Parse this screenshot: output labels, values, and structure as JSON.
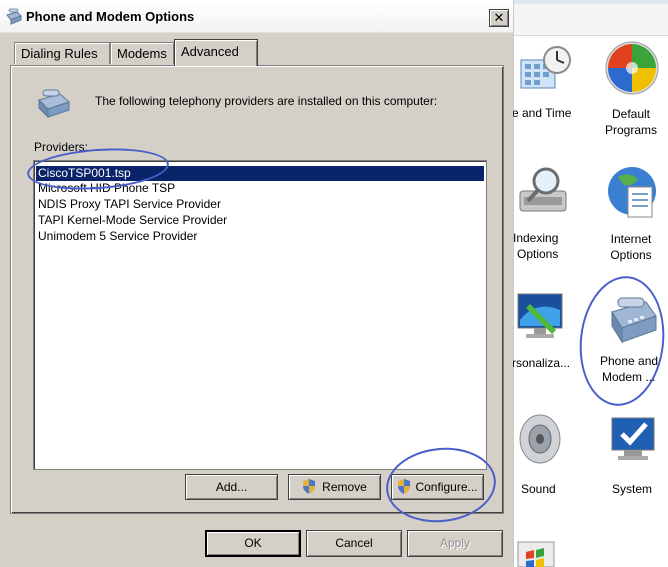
{
  "dialog": {
    "title": "Phone and Modem Options",
    "close_label": "✕",
    "tabs": [
      {
        "label": "Dialing Rules"
      },
      {
        "label": "Modems"
      },
      {
        "label": "Advanced"
      }
    ],
    "intro_text": "The following telephony providers are installed on this computer:",
    "providers_label": "Providers:",
    "providers": [
      "CiscoTSP001.tsp",
      "Microsoft HID Phone TSP",
      "NDIS Proxy TAPI Service Provider",
      "TAPI Kernel-Mode Service Provider",
      "Unimodem 5 Service Provider"
    ],
    "selected_provider_index": 0,
    "buttons": {
      "add": "Add...",
      "remove": "Remove",
      "configure": "Configure...",
      "ok": "OK",
      "cancel": "Cancel",
      "apply": "Apply"
    }
  },
  "control_panel": {
    "items": [
      {
        "label_line1": "e and Time",
        "label_line2": "",
        "icon": "date-time-icon"
      },
      {
        "label_line1": "Default",
        "label_line2": "Programs",
        "icon": "default-programs-icon"
      },
      {
        "label_line1": "Indexing",
        "label_line2": "Options",
        "icon": "indexing-icon"
      },
      {
        "label_line1": "Internet",
        "label_line2": "Options",
        "icon": "internet-options-icon"
      },
      {
        "label_line1": "rsonaliza...",
        "label_line2": "",
        "icon": "personalization-icon"
      },
      {
        "label_line1": "Phone and",
        "label_line2": "Modem ...",
        "icon": "phone-modem-icon"
      },
      {
        "label_line1": "Sound",
        "label_line2": "",
        "icon": "sound-icon"
      },
      {
        "label_line1": "System",
        "label_line2": "",
        "icon": "system-icon"
      }
    ]
  },
  "colors": {
    "selection": "#0a246a",
    "annotation": "#4a5fc9",
    "dialog_face": "#d4d0c8"
  }
}
